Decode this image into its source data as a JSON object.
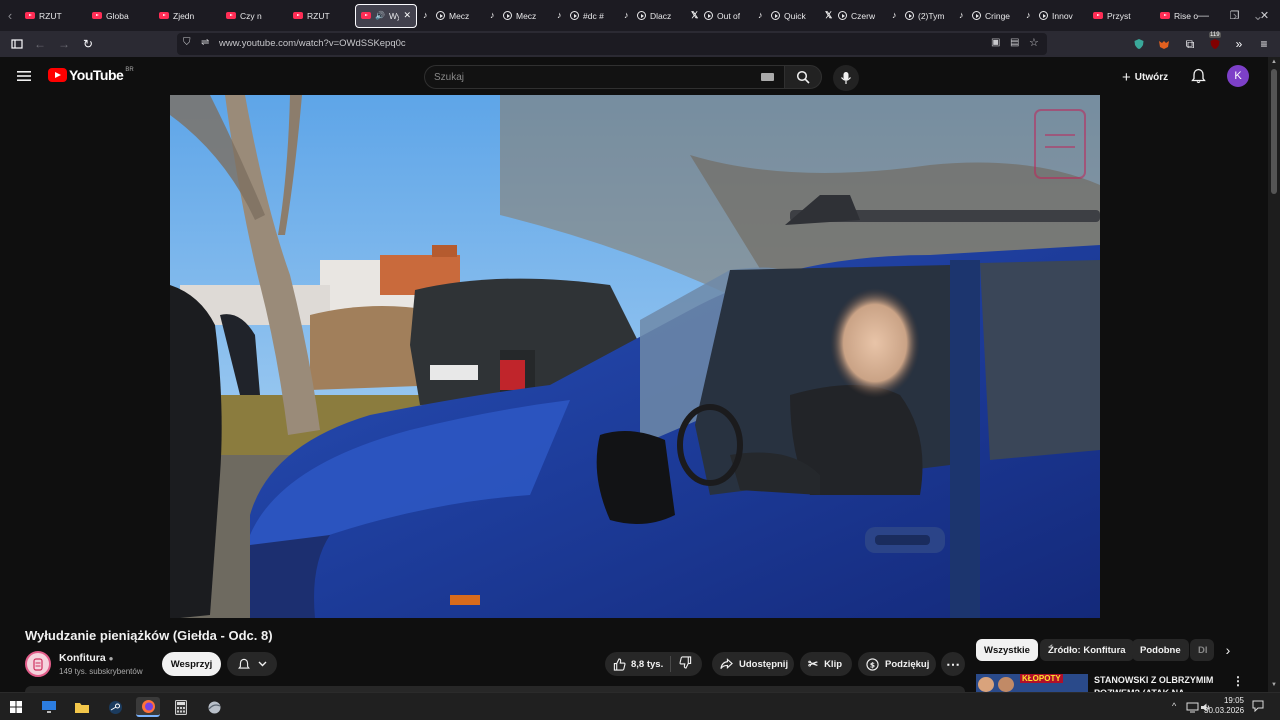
{
  "browser": {
    "tabs": [
      {
        "title": "RZUT",
        "icon": "youtube-icon"
      },
      {
        "title": "Globa",
        "icon": "youtube-icon"
      },
      {
        "title": "Zjedn",
        "icon": "youtube-icon"
      },
      {
        "title": "Czy n",
        "icon": "youtube-icon"
      },
      {
        "title": "RZUT",
        "icon": "youtube-icon"
      },
      {
        "title": "Wy",
        "icon": "youtube-icon",
        "active": true
      },
      {
        "title": "Mecz",
        "icon": "tiktok-icon"
      },
      {
        "title": "Mecz",
        "icon": "tiktok-icon"
      },
      {
        "title": "#dc #",
        "icon": "tiktok-icon"
      },
      {
        "title": "Dlacz",
        "icon": "tiktok-icon"
      },
      {
        "title": "Out of",
        "icon": "x-icon"
      },
      {
        "title": "Quick",
        "icon": "tiktok-icon"
      },
      {
        "title": "Czerw",
        "icon": "x-icon"
      },
      {
        "title": "(2)Tym",
        "icon": "tiktok-icon"
      },
      {
        "title": "Cringe",
        "icon": "tiktok-icon"
      },
      {
        "title": "Innov",
        "icon": "tiktok-icon"
      },
      {
        "title": "Przyst",
        "icon": "youtube-icon"
      },
      {
        "title": "Rise o",
        "icon": "youtube-icon"
      }
    ],
    "url": "www.youtube.com/watch?v=OWdSSKepq0c",
    "extension_badge": "119"
  },
  "youtube": {
    "logo_text": "YouTube",
    "logo_country": "BR",
    "search_placeholder": "Szukaj",
    "create_label": "Utwórz",
    "avatar_letter": "K"
  },
  "video": {
    "title": "Wyłudzanie pieniążków (Giełda - Odc. 8)",
    "channel_name": "Konfitura",
    "subscribers": "149 tys. subskrybentów",
    "support_label": "Wesprzyj",
    "likes": "8,8 tys.",
    "share_label": "Udostępnij",
    "clip_label": "Klip",
    "thanks_label": "Podziękuj"
  },
  "recommendations": {
    "chips": [
      "Wszystkie",
      "Źródło: Konfitura",
      "Podobne",
      "Dl"
    ],
    "first_title": "STANOWSKI Z OLBRZYMIM POZWEM? (ATAK NA",
    "first_thumb_text": "KŁOPOTY"
  },
  "taskbar": {
    "time": "19:05",
    "date": "30.03.2026"
  },
  "colors": {
    "accent_red": "#ff0000",
    "avatar_purple": "#7d40c8",
    "background": "#0f0f0f"
  }
}
